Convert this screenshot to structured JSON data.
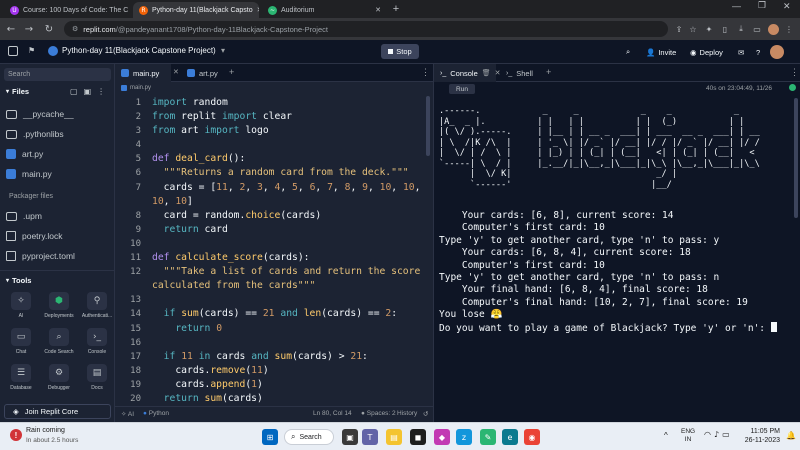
{
  "browser": {
    "tabs": [
      {
        "label": "Course: 100 Days of Code: The C",
        "active": false,
        "favicon": "U",
        "color": "#a435f0"
      },
      {
        "label": "Python-day 11(Blackjack Capsto",
        "active": true,
        "favicon": "R",
        "color": "#f26207"
      },
      {
        "label": "Auditorium",
        "active": false,
        "favicon": "~",
        "color": "#2bb673"
      }
    ],
    "url_domain": "replit.com",
    "url_path": "/@pandeyanant1708/Python-day-11Blackjack-Capstone-Project"
  },
  "header": {
    "project_name": "Python-day 11(Blackjack Capstone Project)",
    "stop_label": "Stop",
    "invite_label": "Invite",
    "deploy_label": "Deploy"
  },
  "sidebar": {
    "search_placeholder": "Search",
    "files_heading": "Files",
    "files": [
      {
        "name": "__pycache__",
        "kind": "folder"
      },
      {
        "name": ".pythonlibs",
        "kind": "folder"
      },
      {
        "name": "art.py",
        "kind": "python"
      },
      {
        "name": "main.py",
        "kind": "python"
      }
    ],
    "packager_heading": "Packager files",
    "packager_files": [
      {
        "name": ".upm",
        "kind": "folder"
      },
      {
        "name": "poetry.lock",
        "kind": "lock"
      },
      {
        "name": "pyproject.toml",
        "kind": "toml"
      }
    ],
    "tools_heading": "Tools",
    "tools": [
      {
        "label": "AI",
        "icon": "ai-icon"
      },
      {
        "label": "Deployments",
        "icon": "deployments-icon"
      },
      {
        "label": "Authenticati...",
        "icon": "auth-icon"
      },
      {
        "label": "Chat",
        "icon": "chat-icon"
      },
      {
        "label": "Code Search",
        "icon": "code-search-icon"
      },
      {
        "label": "Console",
        "icon": "console-icon"
      },
      {
        "label": "Database",
        "icon": "database-icon"
      },
      {
        "label": "Debugger",
        "icon": "debugger-icon"
      },
      {
        "label": "Docs",
        "icon": "docs-icon"
      }
    ],
    "join_label": "Join Replit Core"
  },
  "editor": {
    "tabs": [
      {
        "label": "main.py",
        "active": true
      },
      {
        "label": "art.py",
        "active": false
      }
    ],
    "breadcrumb": "main.py",
    "line_numbers": [
      "1",
      "2",
      "3",
      "4",
      "5",
      "6",
      "7",
      "",
      "8",
      "9",
      "10",
      "11",
      "12",
      "",
      "13",
      "14",
      "15",
      "16",
      "17",
      "18",
      "19",
      "20"
    ],
    "status_left": "Python",
    "status_ai": "AI",
    "status_position": "Ln 80, Col 14",
    "status_spaces": "Spaces: 2",
    "status_history": "History"
  },
  "console": {
    "tabs": [
      {
        "label": "Console",
        "active": true
      },
      {
        "label": "Shell",
        "active": false
      }
    ],
    "run_label": "Run",
    "timestamp": "40s on 23:04:49, 11/26",
    "output_lines": [
      "    Your cards: [6, 8], current score: 14",
      "    Computer's first card: 10",
      "Type 'y' to get another card, type 'n' to pass: y",
      "    Your cards: [6, 8, 4], current score: 18",
      "    Computer's first card: 10",
      "Type 'y' to get another card, type 'n' to pass: n",
      "    Your final hand: [6, 8, 4], final score: 18",
      "    Computer's final hand: [10, 2, 7], final score: 19",
      "You lose 😤",
      "Do you want to play a game of Blackjack? Type 'y' or 'n': "
    ]
  },
  "taskbar": {
    "weather_title": "Rain coming",
    "weather_sub": "In about 2.5 hours",
    "search_label": "Search",
    "lang_top": "ENG",
    "lang_bottom": "IN",
    "time": "11:05 PM",
    "date": "26-11-2023"
  }
}
